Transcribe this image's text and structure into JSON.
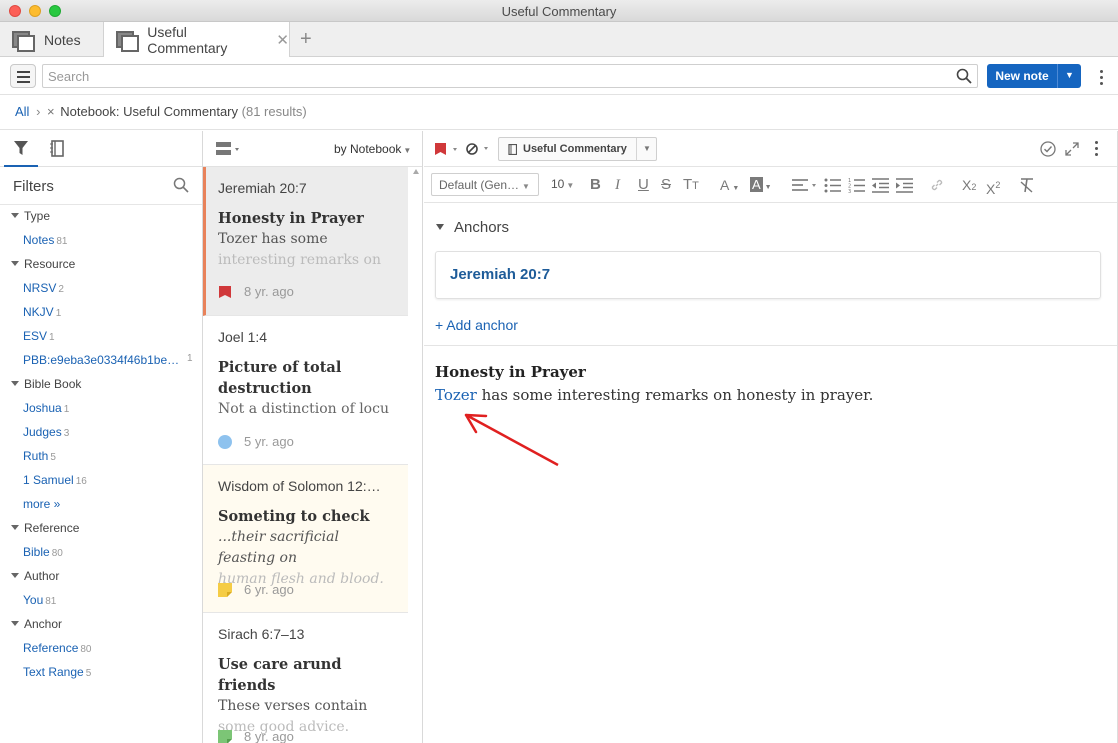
{
  "window": {
    "title": "Useful Commentary"
  },
  "tabs": [
    {
      "label": "Notes"
    },
    {
      "label": "Useful Commentary"
    }
  ],
  "toolbar": {
    "search_placeholder": "Search",
    "new_note_label": "New note"
  },
  "breadcrumb": {
    "all": "All",
    "separator": "›",
    "remove": "×",
    "filter": "Notebook: Useful Commentary",
    "results": "(81 results)"
  },
  "filters": {
    "title": "Filters",
    "groups": [
      {
        "label": "Type",
        "items": [
          {
            "label": "Notes",
            "count": "81"
          }
        ]
      },
      {
        "label": "Resource",
        "items": [
          {
            "label": "NRSV",
            "count": "2"
          },
          {
            "label": "NKJV",
            "count": "1"
          },
          {
            "label": "ESV",
            "count": "1"
          },
          {
            "label": "PBB:e9eba3e0334f46b1be…",
            "count": "1"
          }
        ]
      },
      {
        "label": "Bible Book",
        "items": [
          {
            "label": "Joshua",
            "count": "1"
          },
          {
            "label": "Judges",
            "count": "3"
          },
          {
            "label": "Ruth",
            "count": "5"
          },
          {
            "label": "1 Samuel",
            "count": "16"
          },
          {
            "label": "more »",
            "count": ""
          }
        ]
      },
      {
        "label": "Reference",
        "items": [
          {
            "label": "Bible",
            "count": "80"
          }
        ]
      },
      {
        "label": "Author",
        "items": [
          {
            "label": "You",
            "count": "81"
          }
        ]
      },
      {
        "label": "Anchor",
        "items": [
          {
            "label": "Reference",
            "count": "80"
          },
          {
            "label": "Text Range",
            "count": "5"
          }
        ]
      }
    ]
  },
  "list": {
    "sort_label": "by Notebook",
    "notes": [
      {
        "ref": "Jeremiah 20:7",
        "title": "Honesty in Prayer",
        "body": "Tozer has some",
        "body_fade": "interesting remarks on",
        "age": "8 yr. ago",
        "color": "#d0383a"
      },
      {
        "ref": "Joel 1:4",
        "title": "Picture of total destruction",
        "body": "Not a distinction of locu",
        "body_fade": "",
        "age": "5 yr. ago",
        "color": "#8ec2ee"
      },
      {
        "ref": "Wisdom of Solomon 12:…",
        "title": "Someting to check",
        "body": "...their sacrificial feasting on",
        "body_fade": "human flesh and blood.",
        "age": "6 yr. ago",
        "color": "#f5cc45"
      },
      {
        "ref": "Sirach 6:7–13",
        "title": "Use care arund friends",
        "body": "These verses contain",
        "body_fade": "some good advice.",
        "age": "8 yr. ago",
        "color": "#7cc576"
      }
    ]
  },
  "editor": {
    "notebook": "Useful Commentary",
    "font": "Default (Gen…",
    "font_size": "10",
    "anchors_title": "Anchors",
    "anchor": "Jeremiah 20:7",
    "add_anchor": "+ Add anchor",
    "note_title": "Honesty in Prayer",
    "note_link": "Tozer",
    "note_text": " has some interesting remarks on honesty in prayer."
  },
  "colors": {
    "accent": "#1565c0",
    "link": "#1a62b3",
    "selected_marker": "#e8825a",
    "annotation_arrow": "#e02020"
  }
}
